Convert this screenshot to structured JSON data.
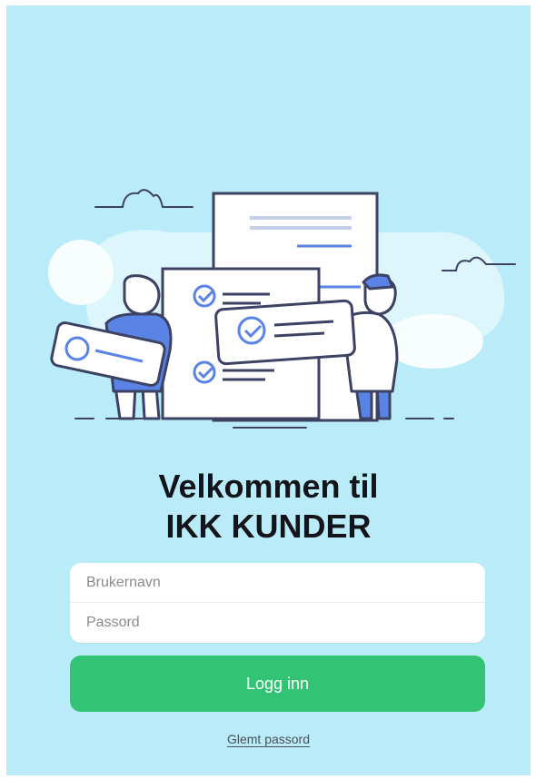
{
  "header": {
    "title_line1": "Velkommen til",
    "title_line2": "IKK KUNDER"
  },
  "login_form": {
    "username_placeholder": "Brukernavn",
    "password_placeholder": "Passord",
    "submit_label": "Logg inn",
    "forgot_password_label": "Glemt passord"
  },
  "illustration": {
    "description_icon": "checklist-people-illustration-icon"
  },
  "colors": {
    "background": "#b9ecf8",
    "accent_green": "#33c374",
    "illustration_blue": "#5a83e6",
    "outline": "#3d4264"
  }
}
